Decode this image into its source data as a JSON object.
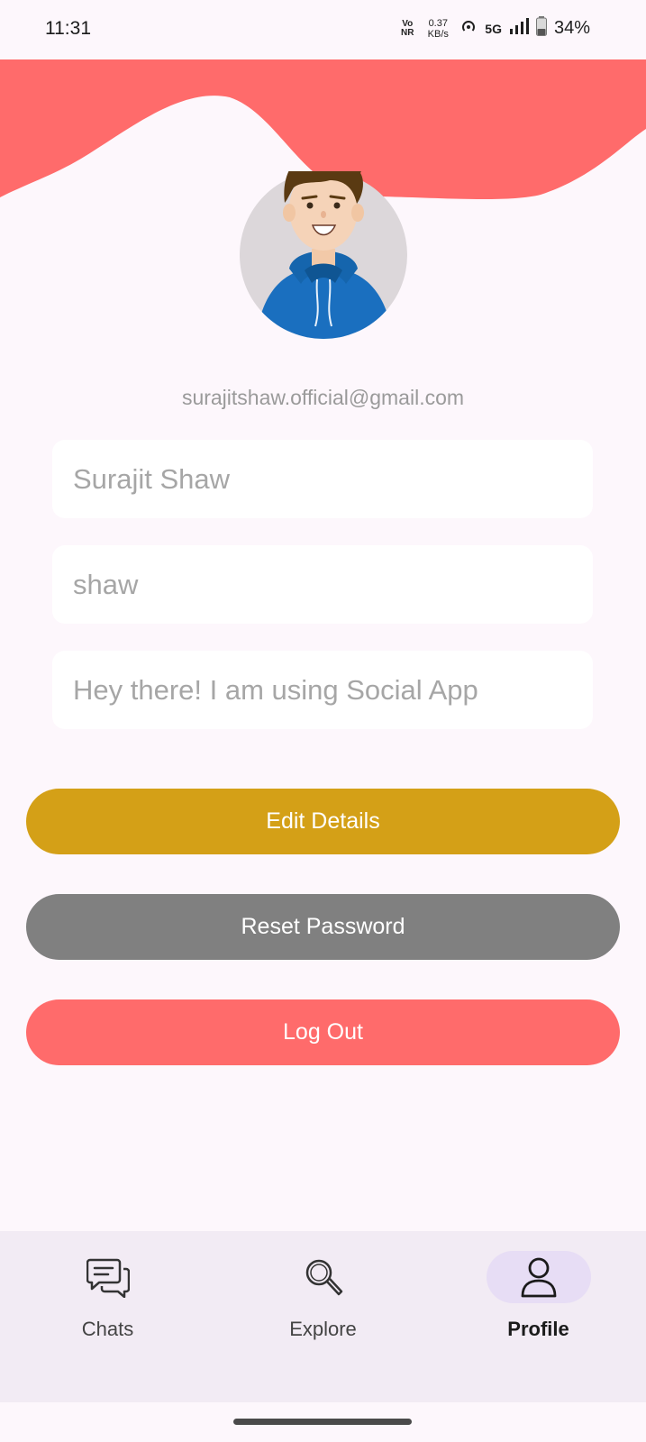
{
  "status_bar": {
    "time": "11:31",
    "vonr_top": "Vo",
    "vonr_bottom": "NR",
    "speed_value": "0.37",
    "speed_unit": "KB/s",
    "network": "5G",
    "battery": "34%"
  },
  "profile": {
    "email": "surajitshaw.official@gmail.com",
    "name_value": "Surajit Shaw",
    "username_value": "shaw",
    "status_value": "Hey there! I am using Social App"
  },
  "buttons": {
    "edit": "Edit Details",
    "reset": "Reset Password",
    "logout": "Log Out"
  },
  "nav": {
    "items": [
      {
        "label": "Chats",
        "icon": "chat-icon",
        "active": false
      },
      {
        "label": "Explore",
        "icon": "search-icon",
        "active": false
      },
      {
        "label": "Profile",
        "icon": "person-icon",
        "active": true
      }
    ]
  },
  "colors": {
    "accent_coral": "#ff6b6b",
    "edit_gold": "#d4a017",
    "reset_gray": "#808080",
    "logout_coral": "#ff6b6b",
    "background": "#fdf7fc",
    "nav_bg": "#f2ebf4",
    "nav_active_pill": "#e7ddf5"
  }
}
